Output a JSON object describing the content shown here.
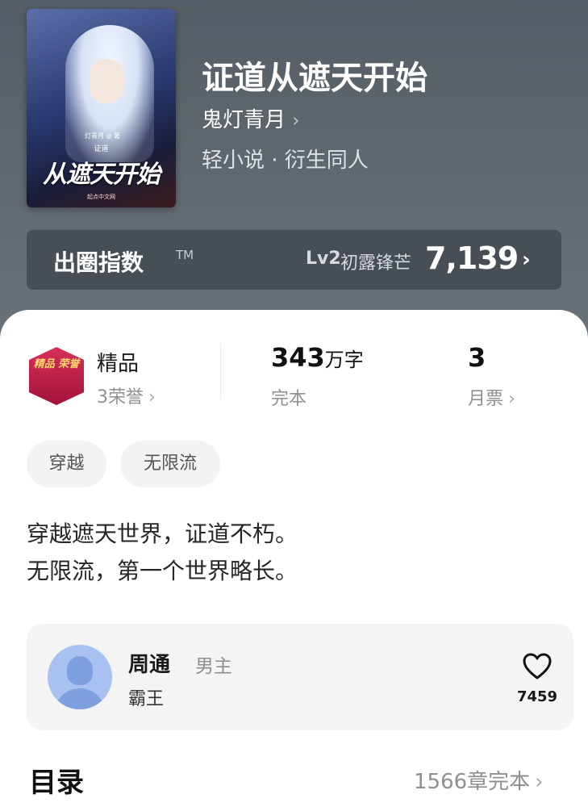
{
  "book": {
    "title": "证道从遮天开始",
    "author": "鬼灯青月",
    "author_chevron": "›",
    "category": "轻小说 · 衍生同人",
    "cover": {
      "author_mini": "灯青月 ◎ 著",
      "subtitle_mini": "证道",
      "title_art": "从遮天开始",
      "publisher": "起点中文网"
    }
  },
  "index": {
    "label": "出圈指数",
    "tm": "TM",
    "level": "Lv2",
    "level_name": "初露锋芒",
    "score": "7,139",
    "arrow": "›"
  },
  "stats": {
    "quality": {
      "badge_text": "精品 荣誉",
      "label": "精品",
      "honors": "3荣誉",
      "chevron": "›"
    },
    "words": {
      "number": "343",
      "unit": "万字",
      "status": "完本"
    },
    "tickets": {
      "number": "3",
      "label": "月票",
      "chevron": "›"
    }
  },
  "tags": [
    "穿越",
    "无限流"
  ],
  "synopsis": [
    "穿越遮天世界，证道不朽。",
    "无限流，第一个世界略长。"
  ],
  "character": {
    "name": "周通",
    "role": "男主",
    "description": "霸王",
    "likes": "7459",
    "icon": "heart-outline-icon"
  },
  "toc": {
    "title": "目录",
    "status": "1566章完本",
    "chevron": "›"
  }
}
